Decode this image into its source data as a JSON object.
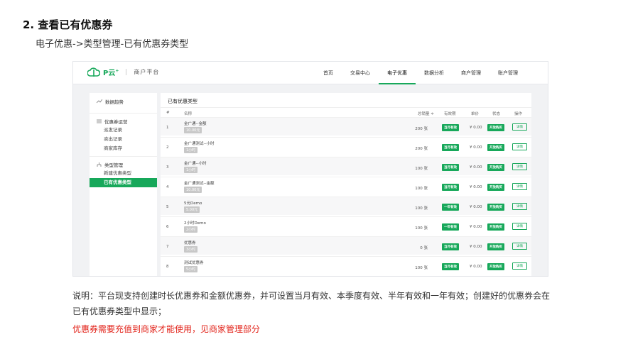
{
  "doc": {
    "heading": "2. 查看已有优惠券",
    "path": "电子优惠->类型管理-已有优惠券类型",
    "note": "说明：平台现支持创建时长优惠券和金额优惠券，并可设置当月有效、本季度有效、半年有效和一年有效；创建好的优惠券会在已有优惠券类型中显示；",
    "warning": "优惠券需要充值到商家才能使用，见商家管理部分"
  },
  "app": {
    "brand": "P云",
    "brand_mark": "+",
    "platform": "商户平台",
    "accent": "#17a85a",
    "nav": [
      "首页",
      "交易中心",
      "电子优惠",
      "数据分析",
      "商户管理",
      "账户管理"
    ],
    "nav_active": "电子优惠",
    "sidebar": {
      "overview": "数据趋势",
      "coupon_ops": "优惠券运营",
      "coupon_items": [
        "派发记录",
        "卖出记录",
        "商家库存"
      ],
      "type_mgmt": "类型管理",
      "type_items": [
        "新建优惠类型",
        "已有优惠类型"
      ],
      "active": "已有优惠类型"
    },
    "main": {
      "title": "已有优惠类型",
      "columns": {
        "idx": "#",
        "name": "名称",
        "total": "总销量 ≑",
        "validity": "有效期",
        "price": "单价",
        "status": "状态",
        "action": "操作"
      },
      "rows": [
        {
          "idx": "1",
          "name": "金广通--金额",
          "tag": "10.00元",
          "total": "200 张",
          "validity": "当月有效",
          "price": "¥ 0.00",
          "status": "开放购买",
          "action": "详情"
        },
        {
          "idx": "2",
          "name": "金广通测试--小时",
          "tag": "1小时",
          "total": "200 张",
          "validity": "当月有效",
          "price": "¥ 0.00",
          "status": "开放购买",
          "action": "详情"
        },
        {
          "idx": "3",
          "name": "金广通--小时",
          "tag": "1小时",
          "total": "100 张",
          "validity": "当月有效",
          "price": "¥ 0.00",
          "status": "开放购买",
          "action": "详情"
        },
        {
          "idx": "4",
          "name": "金广通测试--金额",
          "tag": "10.00元",
          "total": "100 张",
          "validity": "当月有效",
          "price": "¥ 0.00",
          "status": "开放购买",
          "action": "详情"
        },
        {
          "idx": "5",
          "name": "5元Demo",
          "tag": "5.00元",
          "total": "100 张",
          "validity": "一年有效",
          "price": "¥ 0.00",
          "status": "开放购买",
          "action": "详情"
        },
        {
          "idx": "6",
          "name": "2小时Demo",
          "tag": "2小时",
          "total": "100 张",
          "validity": "一年有效",
          "price": "¥ 0.00",
          "status": "开放购买",
          "action": "详情"
        },
        {
          "idx": "7",
          "name": "优惠券",
          "tag": "3小时",
          "total": "0 张",
          "validity": "当月有效",
          "price": "¥ 0.00",
          "status": "开放购买",
          "action": "详情"
        },
        {
          "idx": "8",
          "name": "测试优惠券",
          "tag": "5小时",
          "total": "100 张",
          "validity": "当月有效",
          "price": "¥ 0.00",
          "status": "开放购买",
          "action": "详情"
        }
      ]
    }
  }
}
